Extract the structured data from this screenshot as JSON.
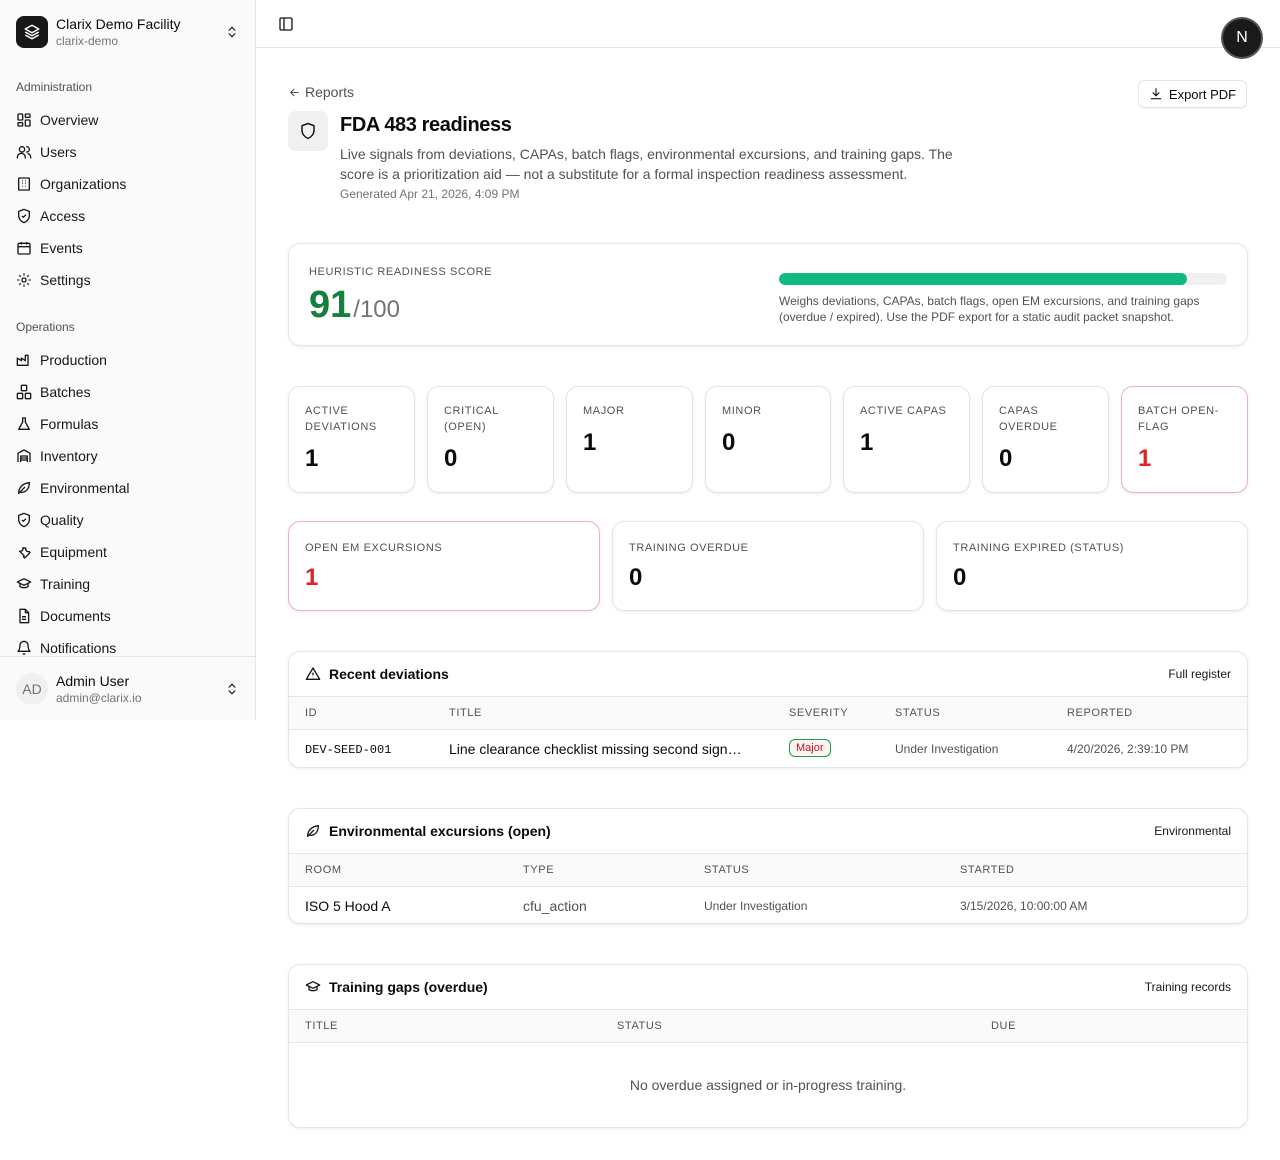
{
  "sidebar": {
    "facility_name": "Clarix Demo Facility",
    "facility_slug": "clarix-demo",
    "groups": [
      "Administration",
      "Operations"
    ],
    "admin_items": [
      {
        "label": "Overview",
        "icon": "grid-icon"
      },
      {
        "label": "Users",
        "icon": "users-icon"
      },
      {
        "label": "Organizations",
        "icon": "building-icon"
      },
      {
        "label": "Access",
        "icon": "shield-check-icon"
      },
      {
        "label": "Events",
        "icon": "calendar-icon"
      },
      {
        "label": "Settings",
        "icon": "gear-icon"
      }
    ],
    "ops_items": [
      {
        "label": "Production",
        "icon": "factory-icon"
      },
      {
        "label": "Batches",
        "icon": "boxes-icon"
      },
      {
        "label": "Formulas",
        "icon": "flask-icon"
      },
      {
        "label": "Inventory",
        "icon": "warehouse-icon"
      },
      {
        "label": "Environmental",
        "icon": "leaf-icon"
      },
      {
        "label": "Quality",
        "icon": "shield-check-icon"
      },
      {
        "label": "Equipment",
        "icon": "wrench-icon"
      },
      {
        "label": "Training",
        "icon": "graduation-cap-icon"
      },
      {
        "label": "Documents",
        "icon": "document-icon"
      },
      {
        "label": "Notifications",
        "icon": "bell-icon"
      }
    ],
    "user": {
      "initials": "AD",
      "name": "Admin User",
      "email": "admin@clarix.io"
    }
  },
  "header": {
    "avatar_letter": "N"
  },
  "page": {
    "back_label": "Reports",
    "export_label": "Export PDF",
    "title": "FDA 483 readiness",
    "description": "Live signals from deviations, CAPAs, batch flags, environmental excursions, and training gaps. The score is a prioritization aid — not a substitute for a formal inspection readiness assessment.",
    "generated": "Generated Apr 21, 2026, 4:09 PM"
  },
  "score": {
    "label": "HEURISTIC READINESS SCORE",
    "value": "91",
    "max": "/100",
    "fraction": 0.91,
    "note": "Weighs deviations, CAPAs, batch flags, open EM excursions, and training gaps (overdue / expired). Use the PDF export for a static audit packet snapshot.",
    "bar_color": "#10b981"
  },
  "metrics_row1": [
    {
      "label": "ACTIVE DEVIATIONS",
      "value": "1",
      "alert": false
    },
    {
      "label": "CRITICAL (OPEN)",
      "value": "0",
      "alert": false
    },
    {
      "label": "MAJOR",
      "value": "1",
      "alert": false
    },
    {
      "label": "MINOR",
      "value": "0",
      "alert": false
    },
    {
      "label": "ACTIVE CAPAS",
      "value": "1",
      "alert": false
    },
    {
      "label": "CAPAS OVERDUE",
      "value": "0",
      "alert": false
    },
    {
      "label": "BATCH OPEN-FLAG",
      "value": "1",
      "alert": true
    }
  ],
  "metrics_row2": [
    {
      "label": "OPEN EM EXCURSIONS",
      "value": "1",
      "alert": true
    },
    {
      "label": "TRAINING OVERDUE",
      "value": "0",
      "alert": false
    },
    {
      "label": "TRAINING EXPIRED (STATUS)",
      "value": "0",
      "alert": false
    }
  ],
  "deviations": {
    "title": "Recent deviations",
    "link": "Full register",
    "columns": [
      "ID",
      "TITLE",
      "SEVERITY",
      "STATUS",
      "REPORTED"
    ],
    "rows": [
      {
        "id": "DEV-SEED-001",
        "title": "Line clearance checklist missing second sign…",
        "severity": "Major",
        "status": "Under Investigation",
        "reported": "4/20/2026, 2:39:10 PM"
      }
    ]
  },
  "excursions": {
    "title": "Environmental excursions (open)",
    "link": "Environmental",
    "columns": [
      "ROOM",
      "TYPE",
      "STATUS",
      "STARTED"
    ],
    "rows": [
      {
        "room": "ISO 5 Hood A",
        "type": "cfu_action",
        "status": "Under Investigation",
        "started": "3/15/2026, 10:00:00 AM"
      }
    ]
  },
  "training": {
    "title": "Training gaps (overdue)",
    "link": "Training records",
    "columns": [
      "TITLE",
      "STATUS",
      "DUE"
    ],
    "empty": "No overdue assigned or in-progress training."
  }
}
